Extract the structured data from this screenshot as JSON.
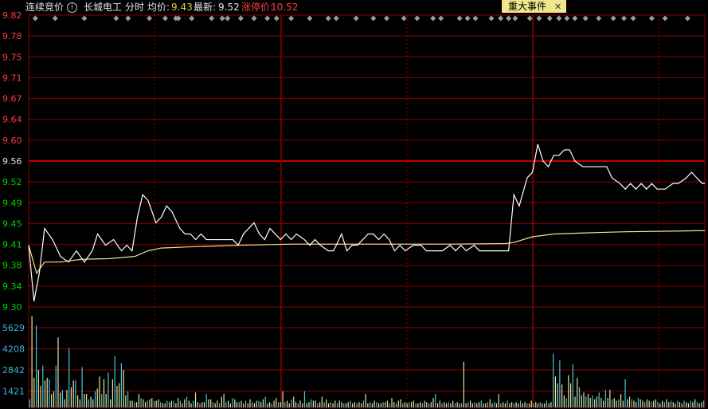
{
  "header": {
    "auction_label": "连续竞价",
    "stock_name": "长城电工",
    "mode": "分时",
    "avg_label": "均价:",
    "avg_value": "9.43",
    "last_label": "最新:",
    "last_value": "9.52",
    "limit_label": "涨停价:",
    "limit_value": "10.52"
  },
  "event_tab": {
    "label": "重大事件",
    "close": "✕"
  },
  "colors": {
    "grid": "#8b0000",
    "up": "#ff3c3c",
    "down": "#00d400",
    "neutral": "#e6e6e6",
    "volume_axis": "#3cb4dc",
    "price_line": "#ffffff",
    "avg_line": "#f0e68c"
  },
  "chart_data": {
    "type": "line",
    "prev_close": 9.56,
    "price_ticks": [
      "9.82",
      "9.78",
      "9.75",
      "9.71",
      "9.67",
      "9.64",
      "9.60",
      "9.56",
      "9.52",
      "9.49",
      "9.45",
      "9.41",
      "9.38",
      "9.34",
      "9.30"
    ],
    "ylim": [
      9.3,
      9.82
    ],
    "volume_ticks": [
      "5629",
      "4208",
      "2842",
      "1421"
    ],
    "volume_ylim": [
      0,
      7000
    ],
    "minutes": 240,
    "price": [
      [
        0,
        9.41
      ],
      [
        4,
        9.31
      ],
      [
        8,
        9.36
      ],
      [
        12,
        9.44
      ],
      [
        18,
        9.42
      ],
      [
        24,
        9.39
      ],
      [
        30,
        9.38
      ],
      [
        36,
        9.4
      ],
      [
        42,
        9.38
      ],
      [
        48,
        9.4
      ],
      [
        52,
        9.43
      ],
      [
        58,
        9.41
      ],
      [
        64,
        9.42
      ],
      [
        70,
        9.4
      ],
      [
        74,
        9.41
      ],
      [
        78,
        9.4
      ],
      [
        82,
        9.46
      ],
      [
        86,
        9.5
      ],
      [
        90,
        9.49
      ],
      [
        96,
        9.45
      ],
      [
        100,
        9.46
      ],
      [
        104,
        9.48
      ],
      [
        108,
        9.47
      ],
      [
        114,
        9.44
      ],
      [
        118,
        9.43
      ],
      [
        122,
        9.43
      ],
      [
        126,
        9.42
      ],
      [
        130,
        9.43
      ],
      [
        134,
        9.42
      ],
      [
        140,
        9.42
      ],
      [
        148,
        9.42
      ],
      [
        154,
        9.42
      ],
      [
        158,
        9.41
      ],
      [
        162,
        9.43
      ],
      [
        166,
        9.44
      ],
      [
        170,
        9.45
      ],
      [
        174,
        9.43
      ],
      [
        178,
        9.42
      ],
      [
        182,
        9.44
      ],
      [
        186,
        9.43
      ],
      [
        190,
        9.42
      ],
      [
        194,
        9.43
      ],
      [
        198,
        9.42
      ],
      [
        202,
        9.43
      ],
      [
        208,
        9.42
      ],
      [
        212,
        9.41
      ],
      [
        216,
        9.42
      ],
      [
        220,
        9.41
      ],
      [
        226,
        9.4
      ],
      [
        230,
        9.4
      ],
      [
        236,
        9.43
      ],
      [
        240,
        9.4
      ],
      [
        244,
        9.41
      ],
      [
        248,
        9.41
      ],
      [
        252,
        9.42
      ],
      [
        256,
        9.43
      ],
      [
        260,
        9.43
      ],
      [
        264,
        9.42
      ],
      [
        268,
        9.43
      ],
      [
        272,
        9.42
      ],
      [
        276,
        9.4
      ],
      [
        280,
        9.41
      ],
      [
        284,
        9.4
      ],
      [
        290,
        9.41
      ],
      [
        296,
        9.41
      ],
      [
        300,
        9.4
      ],
      [
        306,
        9.4
      ],
      [
        312,
        9.4
      ],
      [
        318,
        9.41
      ],
      [
        322,
        9.4
      ],
      [
        326,
        9.41
      ],
      [
        330,
        9.4
      ],
      [
        336,
        9.41
      ],
      [
        340,
        9.4
      ],
      [
        346,
        9.4
      ],
      [
        352,
        9.4
      ],
      [
        358,
        9.4
      ],
      [
        362,
        9.4
      ],
      [
        366,
        9.5
      ],
      [
        370,
        9.48
      ],
      [
        376,
        9.53
      ],
      [
        380,
        9.54
      ],
      [
        384,
        9.59
      ],
      [
        388,
        9.56
      ],
      [
        392,
        9.55
      ],
      [
        396,
        9.57
      ],
      [
        400,
        9.57
      ],
      [
        404,
        9.58
      ],
      [
        408,
        9.58
      ],
      [
        412,
        9.56
      ],
      [
        418,
        9.55
      ],
      [
        424,
        9.55
      ],
      [
        430,
        9.55
      ],
      [
        436,
        9.55
      ],
      [
        440,
        9.53
      ],
      [
        446,
        9.52
      ],
      [
        450,
        9.51
      ],
      [
        454,
        9.52
      ],
      [
        458,
        9.51
      ],
      [
        462,
        9.52
      ],
      [
        466,
        9.51
      ],
      [
        470,
        9.52
      ],
      [
        474,
        9.51
      ],
      [
        480,
        9.51
      ],
      [
        486,
        9.52
      ],
      [
        490,
        9.52
      ],
      [
        496,
        9.53
      ],
      [
        500,
        9.54
      ],
      [
        504,
        9.53
      ],
      [
        508,
        9.52
      ],
      [
        510,
        9.52
      ]
    ],
    "average": [
      [
        0,
        9.41
      ],
      [
        6,
        9.36
      ],
      [
        12,
        9.38
      ],
      [
        24,
        9.38
      ],
      [
        40,
        9.385
      ],
      [
        60,
        9.386
      ],
      [
        80,
        9.39
      ],
      [
        90,
        9.4
      ],
      [
        100,
        9.405
      ],
      [
        120,
        9.407
      ],
      [
        160,
        9.41
      ],
      [
        200,
        9.412
      ],
      [
        240,
        9.412
      ],
      [
        280,
        9.412
      ],
      [
        320,
        9.412
      ],
      [
        360,
        9.413
      ],
      [
        366,
        9.415
      ],
      [
        380,
        9.425
      ],
      [
        396,
        9.43
      ],
      [
        420,
        9.432
      ],
      [
        450,
        9.434
      ],
      [
        480,
        9.435
      ],
      [
        510,
        9.436
      ]
    ],
    "volume": [
      600,
      6800,
      2200,
      6100,
      2800,
      1600,
      3100,
      2000,
      2200,
      2100,
      1000,
      1200,
      3100,
      5200,
      1100,
      1300,
      600,
      1300,
      4400,
      1500,
      2000,
      2000,
      900,
      600,
      3000,
      1000,
      1000,
      600,
      800,
      600,
      1200,
      1400,
      2300,
      1000,
      2100,
      1000,
      2600,
      600,
      2100,
      3800,
      1600,
      1800,
      3300,
      2800,
      900,
      1200,
      500,
      500,
      400,
      400,
      1000,
      700,
      600,
      400,
      500,
      600,
      700,
      500,
      500,
      600,
      400,
      300,
      300,
      500,
      400,
      500,
      500,
      300,
      700,
      500,
      300,
      600,
      800,
      500,
      300,
      500,
      1100,
      400,
      300,
      400,
      400,
      1000,
      600,
      600,
      400,
      300,
      500,
      300,
      800,
      1000,
      400,
      500,
      300,
      700,
      600,
      400,
      400,
      500,
      300,
      500,
      300,
      600,
      400,
      300,
      500,
      500,
      400,
      600,
      800,
      300,
      400,
      300,
      500,
      700,
      400,
      400,
      1200,
      400,
      500,
      300,
      600,
      800,
      400,
      300,
      500,
      300,
      1200,
      300,
      400,
      600,
      500,
      500,
      300,
      400,
      800,
      400,
      600,
      300,
      400,
      300,
      500,
      300,
      500,
      400,
      300,
      300,
      400,
      500,
      300,
      400,
      300,
      400,
      300,
      500,
      1000,
      300,
      400,
      300,
      500,
      400,
      300,
      300,
      400,
      400,
      500,
      300,
      700,
      400,
      300,
      500,
      600,
      300,
      400,
      300,
      400,
      400,
      500,
      300,
      300,
      400,
      300,
      500,
      400,
      300,
      400,
      700,
      1000,
      300,
      500,
      300,
      400,
      300,
      400,
      300,
      500,
      300,
      400,
      300,
      300,
      3400,
      300,
      400,
      500,
      300,
      400,
      300,
      400,
      500,
      300,
      300,
      400,
      600,
      300,
      400,
      300,
      1000,
      300,
      400,
      300,
      500,
      300,
      400,
      300,
      400,
      300,
      500,
      300,
      400,
      300,
      300,
      500,
      300,
      400,
      300,
      400,
      300,
      300,
      500,
      300,
      400,
      4000,
      2300,
      1800,
      3500,
      1700,
      900,
      700,
      2400,
      1800,
      3200,
      800,
      2200,
      1500,
      900,
      1100,
      800,
      1000,
      700,
      900,
      600,
      800,
      1100,
      700,
      500,
      1300,
      700,
      1300,
      600,
      700,
      500,
      600,
      1000,
      500,
      2100,
      600,
      800,
      600,
      500,
      400,
      700,
      600,
      500,
      400,
      600,
      500,
      400,
      500,
      600,
      400,
      300,
      500,
      400,
      600,
      400,
      500,
      400,
      300,
      500,
      400,
      300,
      500,
      400,
      300,
      500,
      400,
      600,
      400,
      300,
      400,
      500
    ],
    "event_markers": [
      5,
      20,
      42,
      66,
      75,
      91,
      103,
      111,
      113,
      123,
      138,
      146,
      150,
      160,
      170,
      180,
      187,
      198,
      212,
      226,
      232,
      247,
      260,
      270,
      283,
      293,
      305,
      311,
      325,
      331,
      337,
      349,
      356,
      362,
      367,
      378,
      385,
      393,
      400,
      406,
      412,
      420,
      430,
      441,
      449,
      456,
      470,
      480,
      497
    ]
  }
}
